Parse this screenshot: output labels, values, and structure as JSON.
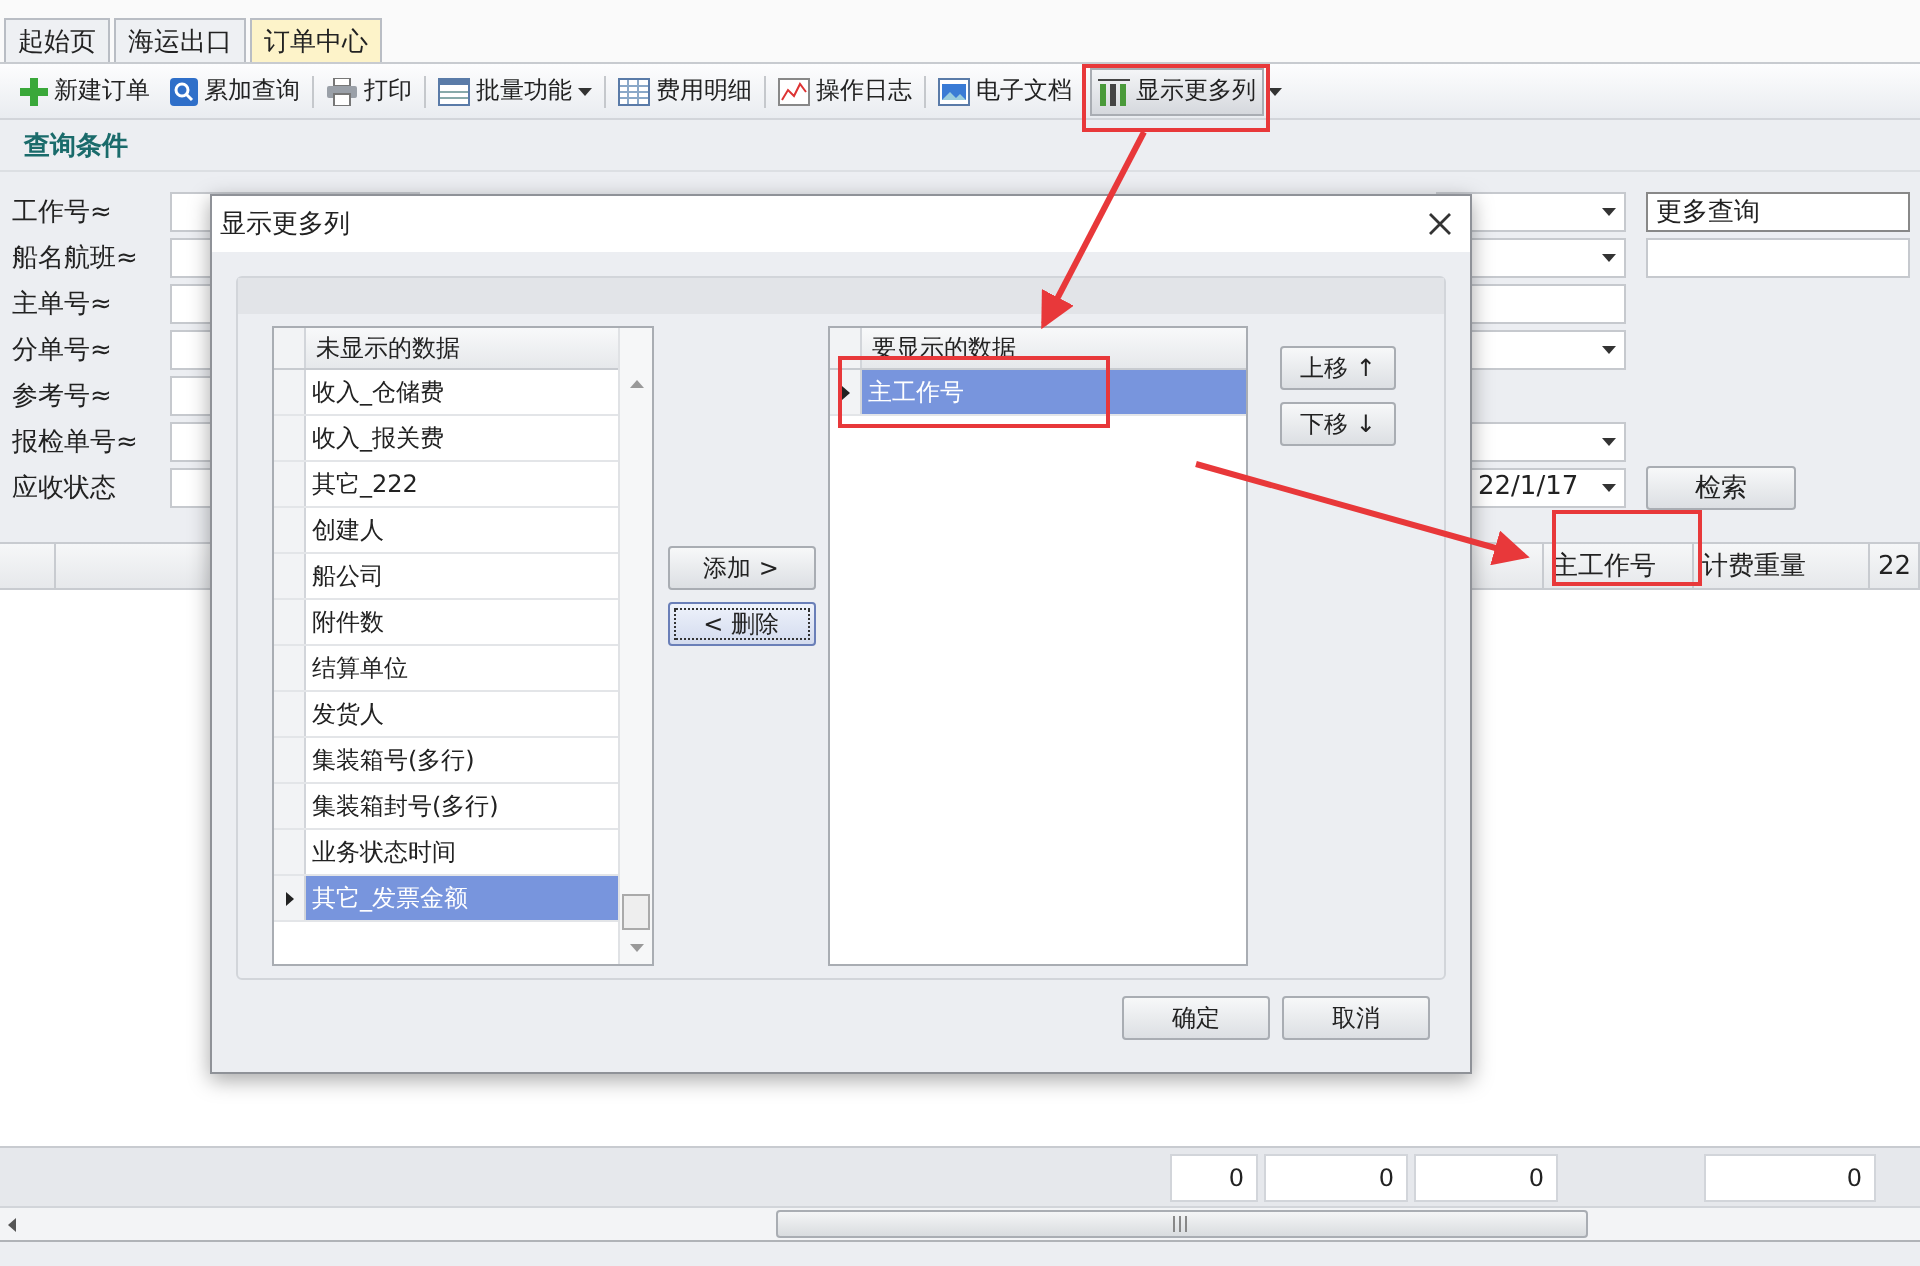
{
  "tabs": [
    {
      "label": "起始页",
      "selected": false
    },
    {
      "label": "海运出口",
      "selected": false
    },
    {
      "label": "订单中心",
      "selected": true
    }
  ],
  "toolbar": [
    {
      "label": "新建订单",
      "kind": "plain"
    },
    {
      "label": "累加查询",
      "kind": "plain"
    },
    {
      "label": "打印",
      "kind": "plain"
    },
    {
      "label": "批量功能",
      "kind": "dropdown"
    },
    {
      "label": "费用明细",
      "kind": "plain"
    },
    {
      "label": "操作日志",
      "kind": "plain"
    },
    {
      "label": "电子文档",
      "kind": "plain"
    },
    {
      "label": "显示更多列",
      "kind": "plain"
    }
  ],
  "query_title": "查询条件",
  "query_fields": [
    {
      "label": "工作号≈"
    },
    {
      "label": "船名航班≈"
    },
    {
      "label": "主单号≈"
    },
    {
      "label": "分单号≈"
    },
    {
      "label": "参考号≈"
    },
    {
      "label": "报检单号≈"
    },
    {
      "label": "应收状态"
    }
  ],
  "right_fields": [
    {
      "kind": "select",
      "extra": {
        "kind": "button-field",
        "value": "更多查询"
      }
    },
    {
      "kind": "select",
      "extra": {
        "kind": "text"
      }
    },
    {
      "kind": "text"
    },
    {
      "kind": "select"
    },
    {
      "kind": "none"
    },
    {
      "kind": "select"
    },
    {
      "kind": "select",
      "value": "22/1/17",
      "extra": {
        "kind": "button",
        "value": "检索"
      }
    }
  ],
  "grid_columns": [
    "主工作号",
    "计费重量",
    "22"
  ],
  "footer_sums": [
    "0",
    "0",
    "0",
    "0"
  ],
  "dialog": {
    "title": "显示更多列",
    "hidden_header": "未显示的数据",
    "hidden_items": [
      {
        "label": "收入_仓储费",
        "selected": false
      },
      {
        "label": "收入_报关费",
        "selected": false
      },
      {
        "label": "其它_222",
        "selected": false
      },
      {
        "label": "创建人",
        "selected": false
      },
      {
        "label": "船公司",
        "selected": false
      },
      {
        "label": "附件数",
        "selected": false
      },
      {
        "label": "结算单位",
        "selected": false
      },
      {
        "label": "发货人",
        "selected": false
      },
      {
        "label": "集装箱号(多行)",
        "selected": false
      },
      {
        "label": "集装箱封号(多行)",
        "selected": false
      },
      {
        "label": "业务状态时间",
        "selected": false
      },
      {
        "label": "其它_发票金额",
        "selected": true
      }
    ],
    "shown_header": "要显示的数据",
    "shown_items": [
      {
        "label": "主工作号",
        "selected": true
      }
    ],
    "add_button": "添加 >",
    "remove_button": "< 删除",
    "up_button": "上移 ↑",
    "down_button": "下移 ↓",
    "ok_button": "确定",
    "cancel_button": "取消"
  }
}
